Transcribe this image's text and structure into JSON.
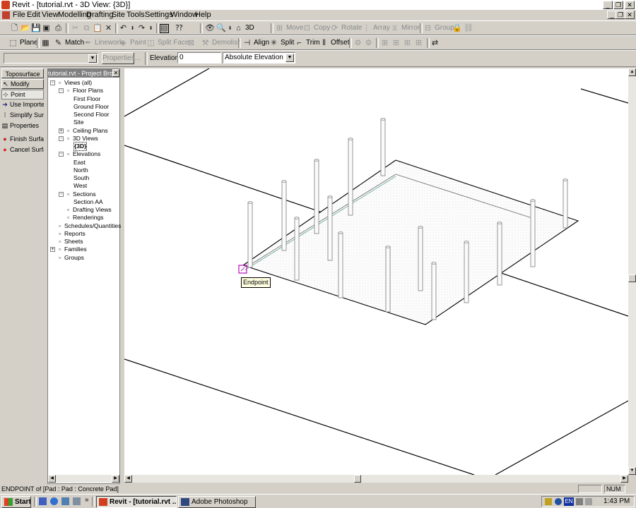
{
  "window": {
    "title": "Revit - [tutorial.rvt - 3D View: {3D}]",
    "min": "_",
    "restore": "❐",
    "close": "✕"
  },
  "menu": [
    "File",
    "Edit",
    "View",
    "Modelling",
    "Drafting",
    "Site",
    "Tools",
    "Settings",
    "Window",
    "Help"
  ],
  "toolbar1": {
    "view_3d": "3D",
    "move": "Move",
    "copy": "Copy",
    "rotate": "Rotate",
    "array": "Array",
    "mirror": "Mirror",
    "group": "Group"
  },
  "toolbar2": {
    "plane": "Plane",
    "match": "Match",
    "linework": "Linework",
    "paint": "Paint",
    "split_face": "Split Face",
    "demolish": "Demolish",
    "align": "Align",
    "split": "Split",
    "trim": "Trim",
    "offset": "Offset"
  },
  "options_bar": {
    "type_selector": "",
    "properties_label": "Properties...",
    "elevation_label": "Elevation",
    "elevation_value": "0",
    "elevation_mode": "Absolute Elevation"
  },
  "design_bar": {
    "header": "Toposurface",
    "items": [
      {
        "label": "Modify",
        "icon": "arrow-cursor-icon"
      },
      {
        "label": "Point",
        "icon": "point-icon"
      },
      {
        "label": "Use Imported",
        "icon": "arrow-right-icon"
      },
      {
        "label": "Simplify Surface",
        "icon": "simplify-icon"
      },
      {
        "label": "Properties",
        "icon": "properties-icon"
      },
      {
        "label": "Finish Surface",
        "icon": "finish-icon"
      },
      {
        "label": "Cancel Surface",
        "icon": "cancel-icon"
      }
    ]
  },
  "project_browser": {
    "title": "tutorial.rvt - Project Browser",
    "tree": [
      {
        "label": "Views (all)",
        "level": 0,
        "toggle": "-",
        "icon": "eye-icon"
      },
      {
        "label": "Floor Plans",
        "level": 1,
        "toggle": "-",
        "icon": "floor-plan-icon"
      },
      {
        "label": "First Floor",
        "level": 2,
        "toggle": "",
        "icon": ""
      },
      {
        "label": "Ground Floor",
        "level": 2,
        "toggle": "",
        "icon": ""
      },
      {
        "label": "Second Floor",
        "level": 2,
        "toggle": "",
        "icon": ""
      },
      {
        "label": "Site",
        "level": 2,
        "toggle": "",
        "icon": ""
      },
      {
        "label": "Ceiling Plans",
        "level": 1,
        "toggle": "+",
        "icon": "ceiling-plan-icon"
      },
      {
        "label": "3D Views",
        "level": 1,
        "toggle": "-",
        "icon": "cube-icon"
      },
      {
        "label": "{3D}",
        "level": 2,
        "toggle": "",
        "icon": "",
        "selected": true
      },
      {
        "label": "Elevations",
        "level": 1,
        "toggle": "-",
        "icon": "elevation-icon"
      },
      {
        "label": "East",
        "level": 2,
        "toggle": "",
        "icon": ""
      },
      {
        "label": "North",
        "level": 2,
        "toggle": "",
        "icon": ""
      },
      {
        "label": "South",
        "level": 2,
        "toggle": "",
        "icon": ""
      },
      {
        "label": "West",
        "level": 2,
        "toggle": "",
        "icon": ""
      },
      {
        "label": "Sections",
        "level": 1,
        "toggle": "-",
        "icon": "section-icon"
      },
      {
        "label": "Section AA",
        "level": 2,
        "toggle": "",
        "icon": ""
      },
      {
        "label": "Drafting Views",
        "level": 1,
        "toggle": "",
        "icon": "drafting-icon"
      },
      {
        "label": "Renderings",
        "level": 1,
        "toggle": "",
        "icon": "rendering-icon"
      },
      {
        "label": "Schedules/Quantities",
        "level": 0,
        "toggle": "",
        "icon": "schedule-icon"
      },
      {
        "label": "Reports",
        "level": 0,
        "toggle": "",
        "icon": "report-icon"
      },
      {
        "label": "Sheets",
        "level": 0,
        "toggle": "",
        "icon": "sheet-icon"
      },
      {
        "label": "Families",
        "level": 0,
        "toggle": "+",
        "icon": "family-icon"
      },
      {
        "label": "Groups",
        "level": 0,
        "toggle": "",
        "icon": "group-icon"
      }
    ]
  },
  "viewport": {
    "snap_tooltip": "Endpoint"
  },
  "status_bar": {
    "message": "ENDPOINT of [Pad : Pad : Concrete Pad]",
    "num_indicator": "NUM"
  },
  "taskbar": {
    "start_label": "Start",
    "tasks": [
      {
        "label": "Revit - [tutorial.rvt ...",
        "active": true
      },
      {
        "label": "Adobe Photoshop",
        "active": false
      }
    ],
    "lang": "EN",
    "clock": "1:43 PM"
  }
}
